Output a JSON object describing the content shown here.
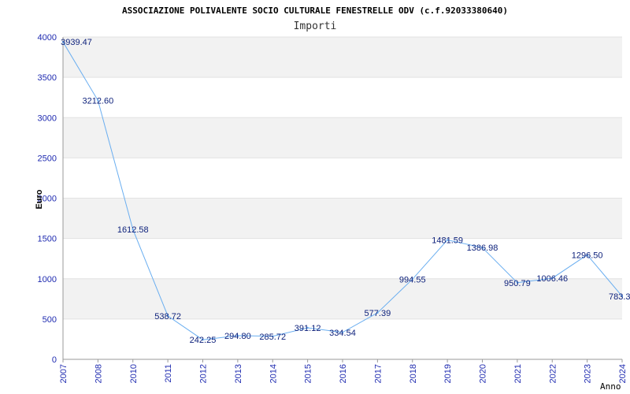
{
  "chart_data": {
    "type": "line",
    "title": "ASSOCIAZIONE POLIVALENTE SOCIO CULTURALE FENESTRELLE ODV (c.f.92033380640)",
    "subtitle": "Importi",
    "xlabel": "Anno",
    "ylabel": "Euro",
    "x": [
      "2007",
      "2008",
      "2010",
      "2011",
      "2012",
      "2013",
      "2014",
      "2015",
      "2016",
      "2017",
      "2018",
      "2019",
      "2020",
      "2021",
      "2022",
      "2023",
      "2024"
    ],
    "series": [
      {
        "values": [
          3939.47,
          3212.6,
          1612.58,
          538.72,
          242.25,
          294.8,
          285.72,
          391.12,
          334.54,
          577.39,
          994.55,
          1481.59,
          1386.98,
          950.79,
          1006.46,
          1296.5,
          783.3
        ],
        "labels": [
          "3939.47",
          "3212.60",
          "1612.58",
          "538.72",
          "242.25",
          "294.80",
          "285.72",
          "391.12",
          "334.54",
          "577.39",
          "994.55",
          "1481.59",
          "1386.98",
          "950.79",
          "1006.46",
          "1296.50",
          "783.3"
        ]
      }
    ],
    "yticks": [
      0,
      500,
      1000,
      1500,
      2000,
      2500,
      3000,
      3500,
      4000
    ],
    "ylim": [
      0,
      4000
    ],
    "grid": "horizontal bands",
    "colors": {
      "line": "#6aaef0",
      "band": "#f2f2f2",
      "tick_text": "#1f2bb0",
      "label_text": "#0b1f7a"
    }
  }
}
